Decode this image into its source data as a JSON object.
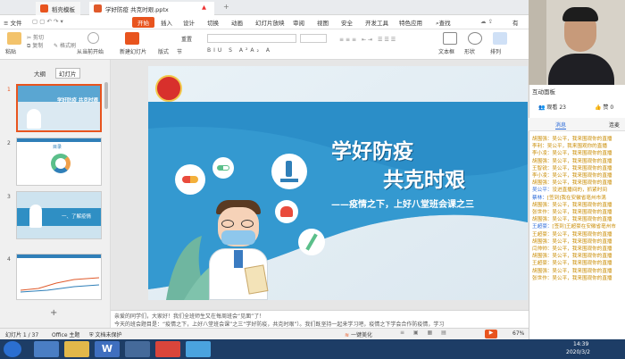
{
  "tabs": {
    "home": "稻壳模板",
    "doc": "学好防疫 共克时艰.pptx"
  },
  "menu": {
    "file": "文件"
  },
  "ribbon_tabs": [
    "开始",
    "插入",
    "设计",
    "切换",
    "动画",
    "幻灯片放映",
    "审阅",
    "视图",
    "安全",
    "开发工具",
    "特色应用"
  ],
  "search": "查找",
  "share": "有",
  "ribbon": {
    "paste": "粘贴",
    "cut": "剪切",
    "copy": "复制",
    "format_painter": "格式刷",
    "play_from": "从当前开始",
    "new_slide": "新建幻灯片",
    "layout": "版式",
    "section": "节",
    "reset": "重置",
    "textbox": "文本框",
    "shape": "形状",
    "arrange": "排列"
  },
  "left_tabs": {
    "outline": "大纲",
    "slides": "幻灯片"
  },
  "thumbs": [
    {
      "n": "1",
      "title": "学好防疫 共克时艰"
    },
    {
      "n": "2",
      "title": "目录"
    },
    {
      "n": "3",
      "title": "一、了解疫情"
    },
    {
      "n": "4",
      "title": ""
    }
  ],
  "slide": {
    "title1": "学好防疫",
    "title2": "共克时艰",
    "subtitle": "——疫情之下，上好八堂班会课之三"
  },
  "notes": "亲爱的同学们，大家好！我们全班师生又在每周班会“见面”了！\n今天的班会题目是：“疫情之下，上好八堂班会课”之三“学好防疫，共克时艰”）。我们既坚持一起来学习吧，疫情之下学会合作防疫情，学习",
  "status": {
    "page": "幻灯片 1 / 37",
    "theme": "Office 主题",
    "protect": "文档未保护",
    "beautify": "一键美化",
    "zoom": "67%"
  },
  "taskbar": {
    "time": "14:39",
    "date": "2020/3/2"
  },
  "panel": {
    "title": "互动面板",
    "viewers_label": "观看",
    "viewers": "23",
    "likes_label": "赞",
    "likes": "0",
    "tab_msg": "消息",
    "tab_other": "连麦"
  },
  "chat": [
    {
      "name": "胡围强：",
      "text": "吴公平，我来围观你的直播"
    },
    {
      "name": "李利：",
      "text": "吴公平，我来围观你的直播"
    },
    {
      "name": "李小凌：",
      "text": "吴公平，我来围观你的直播"
    },
    {
      "name": "胡围强：",
      "text": "吴公平，我来围观你的直播"
    },
    {
      "name": "王智锐：",
      "text": "吴公平，我来围观你的直播"
    },
    {
      "name": "李小凌：",
      "text": "吴公平，我来围观你的直播"
    },
    {
      "name": "胡围强：",
      "text": "吴公平，我来围观你的直播"
    },
    {
      "name": "吴公平：",
      "text": "没进直播间的，抓紧时间",
      "blue": true
    },
    {
      "name": "蔡林：",
      "text": "[签到]我在安徽省亳州市涡",
      "blue": true
    },
    {
      "name": "胡围强：",
      "text": "吴公平，我来围观你的直播"
    },
    {
      "name": "张世作：",
      "text": "吴公平，我来围观你的直播"
    },
    {
      "name": "胡围强：",
      "text": "吴公平，我来围观你的直播"
    },
    {
      "name": "王超豪：",
      "text": "[签到]王超豪在安徽省亳州市",
      "blue": true
    },
    {
      "name": "王超豪：",
      "text": "吴公平，我来围观你的直播"
    },
    {
      "name": "胡围强：",
      "text": "吴公平，我来围观你的直播"
    },
    {
      "name": "闫帅帅：",
      "text": "吴公平，我来围观你的直播"
    },
    {
      "name": "胡围强：",
      "text": "吴公平，我来围观你的直播"
    },
    {
      "name": "王超豪：",
      "text": "吴公平，我来围观你的直播"
    },
    {
      "name": "胡围强：",
      "text": "吴公平，我来围观你的直播"
    },
    {
      "name": "张世作：",
      "text": "吴公平，我来围观你的直播"
    }
  ]
}
